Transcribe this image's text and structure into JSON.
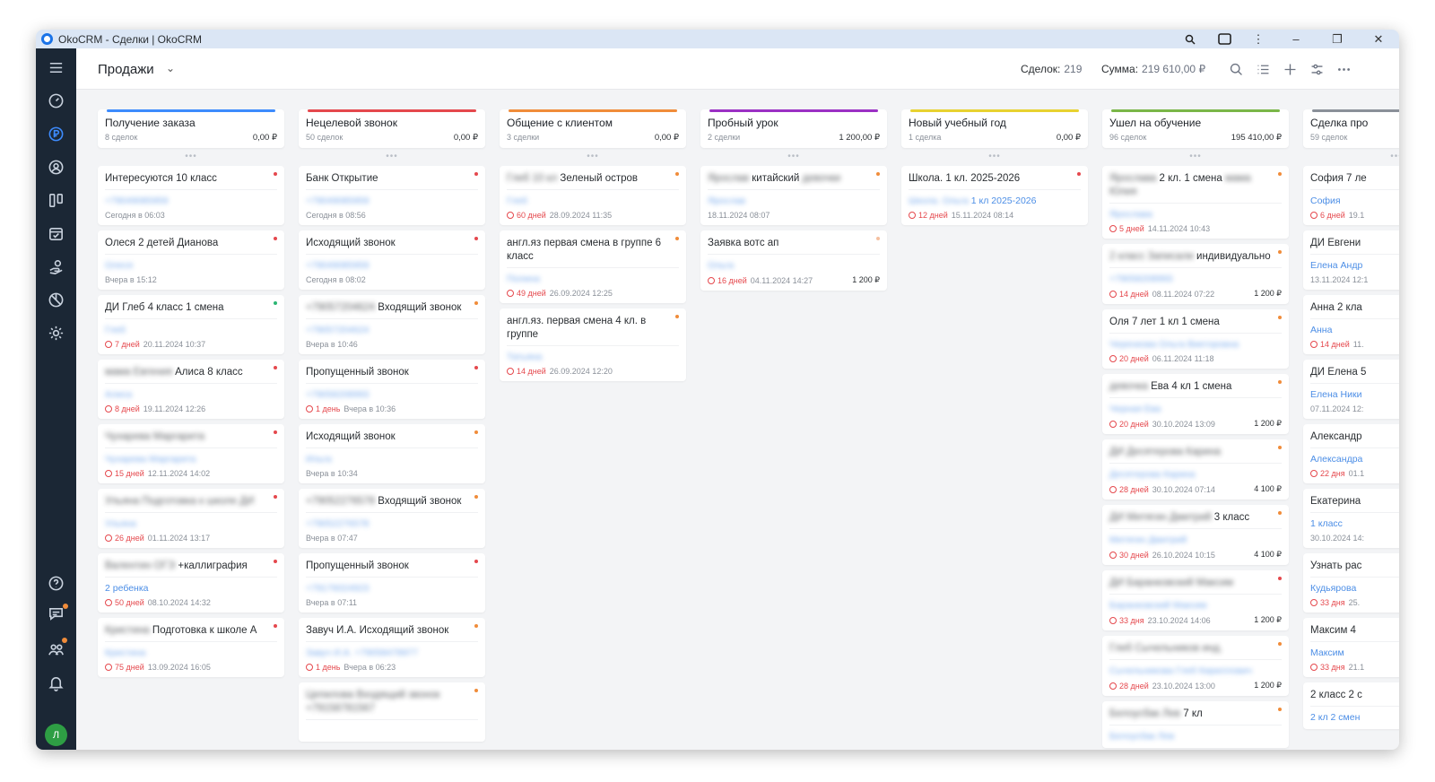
{
  "window": {
    "title": "OkoCRM - Сделки | OkoCRM"
  },
  "header": {
    "title": "Продажи",
    "deals_label": "Сделок:",
    "deals_value": "219",
    "sum_label": "Сумма:",
    "sum_value": "219 610,00 ₽"
  },
  "columns": [
    {
      "name": "Получение заказа",
      "count": "8 сделок",
      "sum": "0,00 ₽",
      "color": "#3d8bfd",
      "cards": [
        {
          "title": "Интересуются 10 класс",
          "contact": "+79049085959",
          "contact_blur": true,
          "overdue": "",
          "date": "Сегодня в 06:03",
          "amount": "",
          "dot": "#e5484d"
        },
        {
          "title": "Олеся 2 детей Дианова",
          "contact": "Олеся",
          "contact_blur": true,
          "overdue": "",
          "date": "Вчера в 15:12",
          "amount": "",
          "dot": "#e5484d"
        },
        {
          "title": "ДИ Глеб 4 класс 1 смена",
          "contact": "Глеб",
          "contact_blur": true,
          "overdue": "7 дней",
          "date": "20.11.2024 10:37",
          "amount": "",
          "dot": "#2bb673"
        },
        {
          "title": "Алиса 8 класс",
          "title_blur": "мама Евгения",
          "contact": "Алиса",
          "contact_blur": true,
          "overdue": "8 дней",
          "date": "19.11.2024 12:26",
          "amount": "",
          "dot": "#e5484d"
        },
        {
          "title": "",
          "title_blur": "Чухарева Маргарита",
          "contact": "Чухарева Маргарита",
          "contact_blur": true,
          "overdue": "15 дней",
          "date": "12.11.2024 14:02",
          "amount": "",
          "dot": "#e5484d"
        },
        {
          "title": "",
          "title_blur": "Ульяна Подготовка к школе ДИ",
          "contact": "Ульяна",
          "contact_blur": true,
          "overdue": "26 дней",
          "date": "01.11.2024 13:17",
          "amount": "",
          "dot": "#e5484d"
        },
        {
          "title": "+каллиграфия",
          "title_blur": "Валентин ОГЭ",
          "contact": "2 ребенка",
          "contact_blur": false,
          "overdue": "50 дней",
          "date": "08.10.2024 14:32",
          "amount": "",
          "dot": "#e5484d"
        },
        {
          "title": "Подготовка к школе А",
          "title_blur": "Кристина",
          "contact": "Кристина",
          "contact_blur": true,
          "overdue": "75 дней",
          "date": "13.09.2024 16:05",
          "amount": "",
          "dot": "#e5484d"
        }
      ]
    },
    {
      "name": "Нецелевой звонок",
      "count": "50 сделок",
      "sum": "0,00 ₽",
      "color": "#e5484d",
      "cards": [
        {
          "title": "Банк Открытие",
          "contact": "+79049085959",
          "contact_blur": true,
          "overdue": "",
          "date": "Сегодня в 08:56",
          "amount": "",
          "dot": "#e5484d"
        },
        {
          "title": "Исходящий звонок",
          "contact": "+79049085959",
          "contact_blur": true,
          "overdue": "",
          "date": "Сегодня в 08:02",
          "amount": "",
          "dot": "#e5484d"
        },
        {
          "title": "Входящий звонок",
          "title_blur": "+79057204624",
          "contact": "+79057204624",
          "contact_blur": true,
          "overdue": "",
          "date": "Вчера в 10:46",
          "amount": "",
          "dot": "#f08c3a"
        },
        {
          "title": "Пропущенный звонок",
          "contact": "+79058208993",
          "contact_blur": true,
          "overdue": "1 день",
          "date": "Вчера в 10:36",
          "amount": "",
          "dot": "#e5484d"
        },
        {
          "title": "Исходящий звонок",
          "contact": "Ильга",
          "contact_blur": true,
          "overdue": "",
          "date": "Вчера в 10:34",
          "amount": "",
          "dot": "#f08c3a"
        },
        {
          "title": "Входящий звонок",
          "title_blur": "+79052276578",
          "contact": "+79052276578",
          "contact_blur": true,
          "overdue": "",
          "date": "Вчера в 07:47",
          "amount": "",
          "dot": "#f08c3a"
        },
        {
          "title": "Пропущенный звонок",
          "contact": "+79176024923",
          "contact_blur": true,
          "overdue": "",
          "date": "Вчера в 07:11",
          "amount": "",
          "dot": "#e5484d"
        },
        {
          "title": "Завуч И.А. Исходящий звонок",
          "contact": "Завуч И.А. +79058478977",
          "contact_blur": true,
          "overdue": "1 день",
          "date": "Вчера в 06:23",
          "amount": "",
          "dot": "#f08c3a"
        },
        {
          "title": "",
          "title_blur": "Цепилова Входящий звонок +79158781567",
          "contact": "",
          "contact_blur": true,
          "overdue": "",
          "date": "",
          "amount": "",
          "dot": "#f08c3a"
        }
      ]
    },
    {
      "name": "Общение с клиентом",
      "count": "3 сделки",
      "sum": "0,00 ₽",
      "color": "#f08c3a",
      "cards": [
        {
          "title": "Зеленый остров",
          "title_blur": "Глеб 10 кл",
          "contact": "Глеб",
          "contact_blur": true,
          "overdue": "60 дней",
          "date": "28.09.2024 11:35",
          "amount": "",
          "dot": "#f08c3a"
        },
        {
          "title": "англ.яз первая смена в группе 6 класс",
          "contact": "Полина",
          "contact_blur": true,
          "overdue": "49 дней",
          "date": "26.09.2024 12:25",
          "amount": "",
          "dot": "#f08c3a"
        },
        {
          "title": "англ.яз. первая смена 4 кл. в группе",
          "contact": "Татьяна",
          "contact_blur": true,
          "overdue": "14 дней",
          "date": "26.09.2024 12:20",
          "amount": "",
          "dot": "#f08c3a"
        }
      ]
    },
    {
      "name": "Пробный урок",
      "count": "2 сделки",
      "sum": "1 200,00 ₽",
      "color": "#9b30c4",
      "cards": [
        {
          "title": "китайский",
          "title_blur": "Ярослав",
          "title_blur2": "девочки",
          "contact": "Ярослав",
          "contact_blur": true,
          "overdue": "",
          "date": "18.11.2024 08:07",
          "amount": "",
          "dot": "#f08c3a"
        },
        {
          "title": "Заявка вотс ап",
          "contact": "Ольга",
          "contact_blur": true,
          "overdue": "16 дней",
          "date": "04.11.2024 14:27",
          "amount": "1 200 ₽",
          "dot": "#f5c0a0"
        }
      ]
    },
    {
      "name": "Новый учебный год",
      "count": "1 сделка",
      "sum": "0,00 ₽",
      "color": "#e8d230",
      "cards": [
        {
          "title": "Школа. 1 кл. 2025-2026",
          "contact": "1 кл 2025-2026",
          "contact_prefix_blur": "Школа. Ольга",
          "contact_blur": false,
          "overdue": "12 дней",
          "date": "15.11.2024 08:14",
          "amount": "",
          "dot": "#e5484d"
        }
      ]
    },
    {
      "name": "Ушел на обучение",
      "count": "96 сделок",
      "sum": "195 410,00 ₽",
      "color": "#7ab648",
      "cards": [
        {
          "title": "2 кл. 1 смена",
          "title_blur": "Ярослава",
          "title_blur2": "мама Юлия",
          "contact": "Ярослава",
          "contact_blur": true,
          "overdue": "5 дней",
          "date": "14.11.2024 10:43",
          "amount": "",
          "dot": "#f08c3a"
        },
        {
          "title": "индивидуально",
          "title_blur": "2 класс Записали",
          "contact": "+79058208993",
          "contact_blur": true,
          "overdue": "14 дней",
          "date": "08.11.2024 07:22",
          "amount": "1 200 ₽",
          "dot": "#f08c3a"
        },
        {
          "title": "Оля 7 лет 1 кл 1 смена",
          "contact": "Черенкова Ольга Викторовна",
          "contact_blur": true,
          "overdue": "20 дней",
          "date": "06.11.2024 11:18",
          "amount": "",
          "dot": "#f08c3a"
        },
        {
          "title": "Ева 4 кл 1 смена",
          "title_blur": "девочка",
          "contact": "Черная Ева",
          "contact_blur": true,
          "overdue": "20 дней",
          "date": "30.10.2024 13:09",
          "amount": "1 200 ₽",
          "dot": "#f08c3a"
        },
        {
          "title": "",
          "title_blur": "ДИ Десятерова Карина",
          "contact": "Десятерова Карина",
          "contact_blur": true,
          "overdue": "28 дней",
          "date": "30.10.2024 07:14",
          "amount": "4 100 ₽",
          "dot": "#f08c3a"
        },
        {
          "title": "3 класс",
          "title_blur": "ДИ Митягин Дмитрий",
          "contact": "Митягин Дмитрий",
          "contact_blur": true,
          "overdue": "30 дней",
          "date": "26.10.2024 10:15",
          "amount": "4 100 ₽",
          "dot": "#f08c3a"
        },
        {
          "title": "",
          "title_blur": "ДИ Баранковский Максим",
          "contact": "Баранковский Максим",
          "contact_blur": true,
          "overdue": "33 дня",
          "date": "23.10.2024 14:06",
          "amount": "1 200 ₽",
          "dot": "#e5484d"
        },
        {
          "title": "",
          "title_blur": "Глеб Сычельников инд.",
          "contact": "Сычельникова Глеб Кириллович",
          "contact_blur": true,
          "overdue": "28 дней",
          "date": "23.10.2024 13:00",
          "amount": "1 200 ₽",
          "dot": "#f08c3a"
        },
        {
          "title": "7 кл",
          "title_blur": "Белоусбак Лев",
          "contact": "Белоусбак Лев",
          "contact_blur": true,
          "overdue": "",
          "date": "",
          "amount": "",
          "dot": "#f08c3a"
        }
      ]
    },
    {
      "name": "Сделка про",
      "count": "59 сделок",
      "sum": "",
      "color": "#8a9099",
      "cards": [
        {
          "title": "София 7 ле",
          "contact": "София",
          "contact_blur": false,
          "overdue": "6 дней",
          "date": "19.1",
          "amount": "",
          "dot": ""
        },
        {
          "title": "ДИ Евгени",
          "contact": "Елена Андр",
          "contact_blur": false,
          "overdue": "",
          "date": "13.11.2024 12:1",
          "amount": "",
          "dot": ""
        },
        {
          "title": "Анна 2 кла",
          "contact": "Анна",
          "contact_blur": false,
          "overdue": "14 дней",
          "date": "11.",
          "amount": "",
          "dot": ""
        },
        {
          "title": "ДИ Елена 5",
          "contact": "Елена Ники",
          "contact_blur": false,
          "overdue": "",
          "date": "07.11.2024 12:",
          "amount": "",
          "dot": ""
        },
        {
          "title": "Александр",
          "contact": "Александра",
          "contact_blur": false,
          "overdue": "22 дня",
          "date": "01.1",
          "amount": "",
          "dot": ""
        },
        {
          "title": "Екатерина",
          "contact": "1 класс",
          "contact_blur": false,
          "overdue": "",
          "date": "30.10.2024 14:",
          "amount": "",
          "dot": ""
        },
        {
          "title": "Узнать рас",
          "contact": "Кудьярова",
          "contact_blur": false,
          "overdue": "33 дня",
          "date": "25.",
          "amount": "",
          "dot": ""
        },
        {
          "title": "Максим 4",
          "contact": "Максим",
          "contact_blur": false,
          "overdue": "33 дня",
          "date": "21.1",
          "amount": "",
          "dot": ""
        },
        {
          "title": "2 класс 2 с",
          "contact": "2 кл 2 смен",
          "contact_blur": false,
          "overdue": "",
          "date": "",
          "amount": "",
          "dot": ""
        }
      ]
    }
  ],
  "icons": {
    "sidebar": [
      "menu-icon",
      "dashboard-icon",
      "deals-icon",
      "contacts-icon",
      "board-icon",
      "calendar-icon",
      "hand-icon",
      "stats-icon",
      "settings-icon",
      "help-icon",
      "chat-icon",
      "team-icon",
      "bell-icon"
    ],
    "avatar_letter": "Л"
  },
  "colors": {
    "accent": "#3d8bfd",
    "sidebar": "#1b2735",
    "overdue": "#e5484d",
    "link": "#4c8ee6"
  }
}
